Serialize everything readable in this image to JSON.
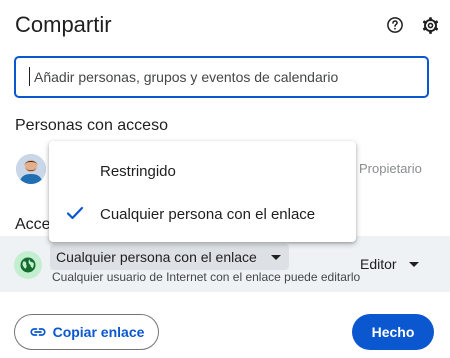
{
  "dialog": {
    "title": "Compartir",
    "help_icon": "help-circle-icon",
    "settings_icon": "gear-icon"
  },
  "search": {
    "placeholder": "Añadir personas, grupos y eventos de calendario"
  },
  "people": {
    "section_title": "Personas con acceso",
    "owner_role": "Propietario"
  },
  "general_access": {
    "section_title": "Acceso general",
    "section_title_visible": "Acce",
    "selected": "Cualquier persona con el enlace",
    "description": "Cualquier usuario de Internet con el enlace puede editarlo",
    "role": "Editor",
    "icon": "globe-icon",
    "options": [
      {
        "label": "Restringido",
        "selected": false
      },
      {
        "label": "Cualquier persona con el enlace",
        "selected": true
      }
    ]
  },
  "footer": {
    "copy_link_label": "Copiar enlace",
    "done_label": "Hecho"
  },
  "colors": {
    "accent": "#0b57d0",
    "globe_bg": "#c4eed0",
    "globe_fg": "#146c2e",
    "row_bg": "#eff2f5"
  }
}
